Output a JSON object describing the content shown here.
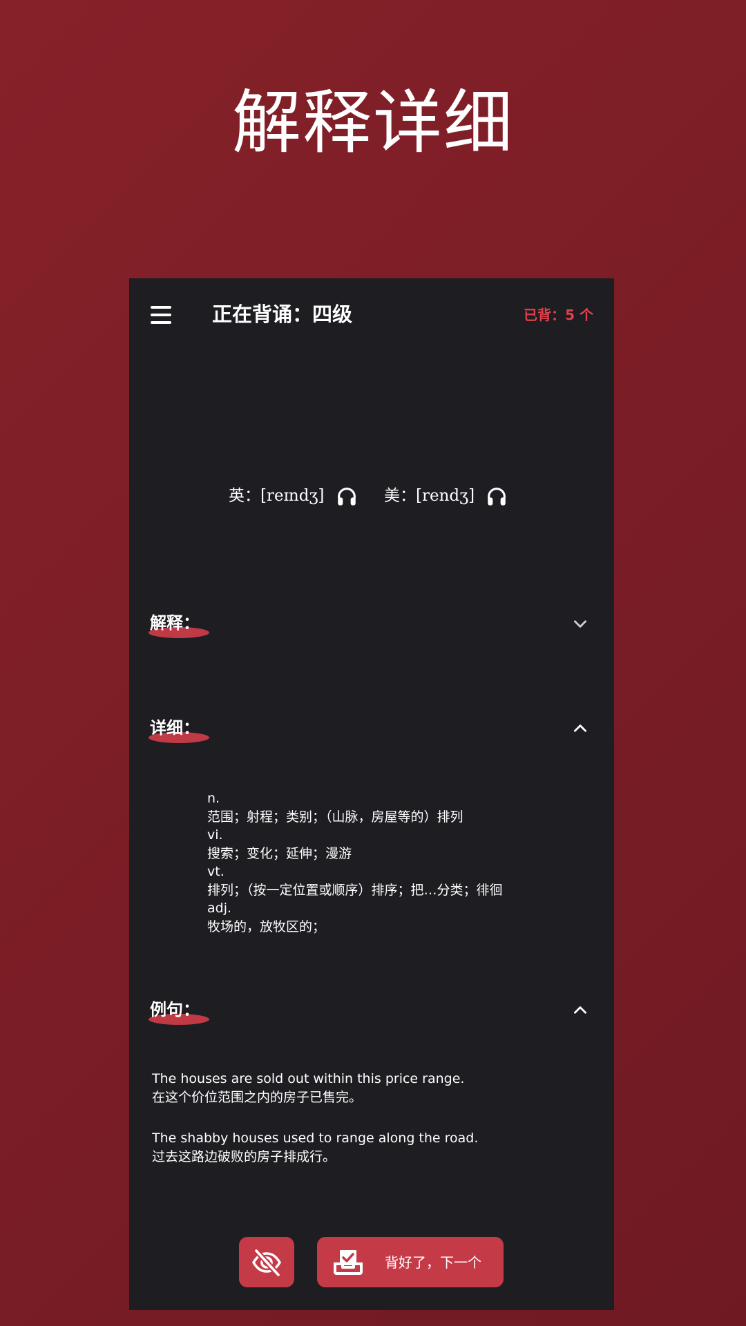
{
  "hero": {
    "title": "解释详细"
  },
  "appbar": {
    "menu_icon": "menu-icon",
    "title": "正在背诵：四级",
    "count": "已背：5 个"
  },
  "phonetics": {
    "uk_label": "英：[reɪndʒ]",
    "us_label": "美：[rendʒ]",
    "icon": "headphone-icon"
  },
  "sections": {
    "meaning": {
      "label": "解释：",
      "state": "collapsed",
      "icon": "chevron-down-icon"
    },
    "detail": {
      "label": "详细：",
      "state": "expanded",
      "icon": "chevron-up-icon"
    },
    "examples": {
      "label": "例句：",
      "state": "expanded",
      "icon": "chevron-up-icon"
    }
  },
  "detail_lines": [
    "n.",
    "范围；射程；类别；（山脉，房屋等的）排列",
    "vi.",
    "搜索；变化；延伸；漫游",
    "vt.",
    "排列；（按一定位置或顺序）排序；把…分类；徘徊",
    "adj.",
    "牧场的，放牧区的；"
  ],
  "examples": [
    {
      "en": "The houses are sold out within this price range.",
      "zh": "在这个价位范围之内的房子已售完。"
    },
    {
      "en": "The shabby houses used to range along the road.",
      "zh": "过去这路边破败的房子排成行。"
    }
  ],
  "actions": {
    "hide_icon": "eye-off-icon",
    "next_icon": "inbox-check-icon",
    "next_label": "背好了，下一个"
  },
  "colors": {
    "background": "#7b1d26",
    "panel": "#1d1d22",
    "accent": "#c53a47",
    "count_text": "#e0414d",
    "text": "#ffffff"
  }
}
